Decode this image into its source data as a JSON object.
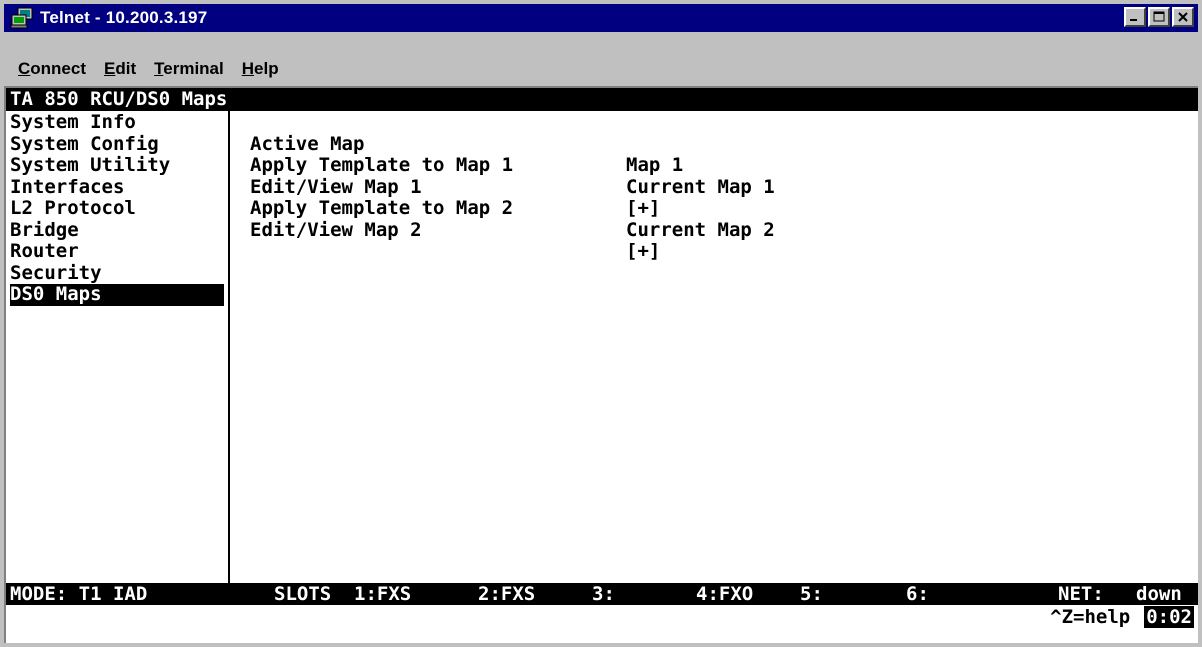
{
  "window": {
    "title": "Telnet - 10.200.3.197",
    "title_color": "#000080",
    "icon": "telnet-computer-icon"
  },
  "titlebar_buttons": {
    "minimize": "minimize-icon",
    "maximize": "maximize-icon",
    "close": "close-icon"
  },
  "menubar": {
    "items": [
      {
        "accel": "C",
        "rest": "onnect"
      },
      {
        "accel": "E",
        "rest": "dit"
      },
      {
        "accel": "T",
        "rest": "erminal"
      },
      {
        "accel": "H",
        "rest": "elp"
      }
    ]
  },
  "terminal": {
    "header": "TA 850 RCU/DS0 Maps",
    "left_menu": [
      "System Info",
      "System Config",
      "System Utility",
      "Interfaces",
      "L2 Protocol",
      "Bridge",
      "Router",
      "Security",
      "DS0 Maps"
    ],
    "selected_menu_index": 8,
    "rows": [
      {
        "label": "Active Map",
        "value": "Map 1"
      },
      {
        "label": "Apply Template to Map 1",
        "value": "Current Map 1"
      },
      {
        "label": "Edit/View Map 1",
        "value": "[+]"
      },
      {
        "label": "Apply Template to Map 2",
        "value": "Current Map 2"
      },
      {
        "label": "Edit/View Map 2",
        "value": "[+]"
      }
    ],
    "status": {
      "mode": "MODE: T1 IAD",
      "slots_label": "SLOTS",
      "slot1": "1:FXS",
      "slot2": "2:FXS",
      "slot3": "3:",
      "slot4": "4:FXO",
      "slot5": "5:",
      "slot6": "6:",
      "net_label": "NET:",
      "net_value": "down"
    },
    "help": "^Z=help",
    "clock": "0:02"
  }
}
